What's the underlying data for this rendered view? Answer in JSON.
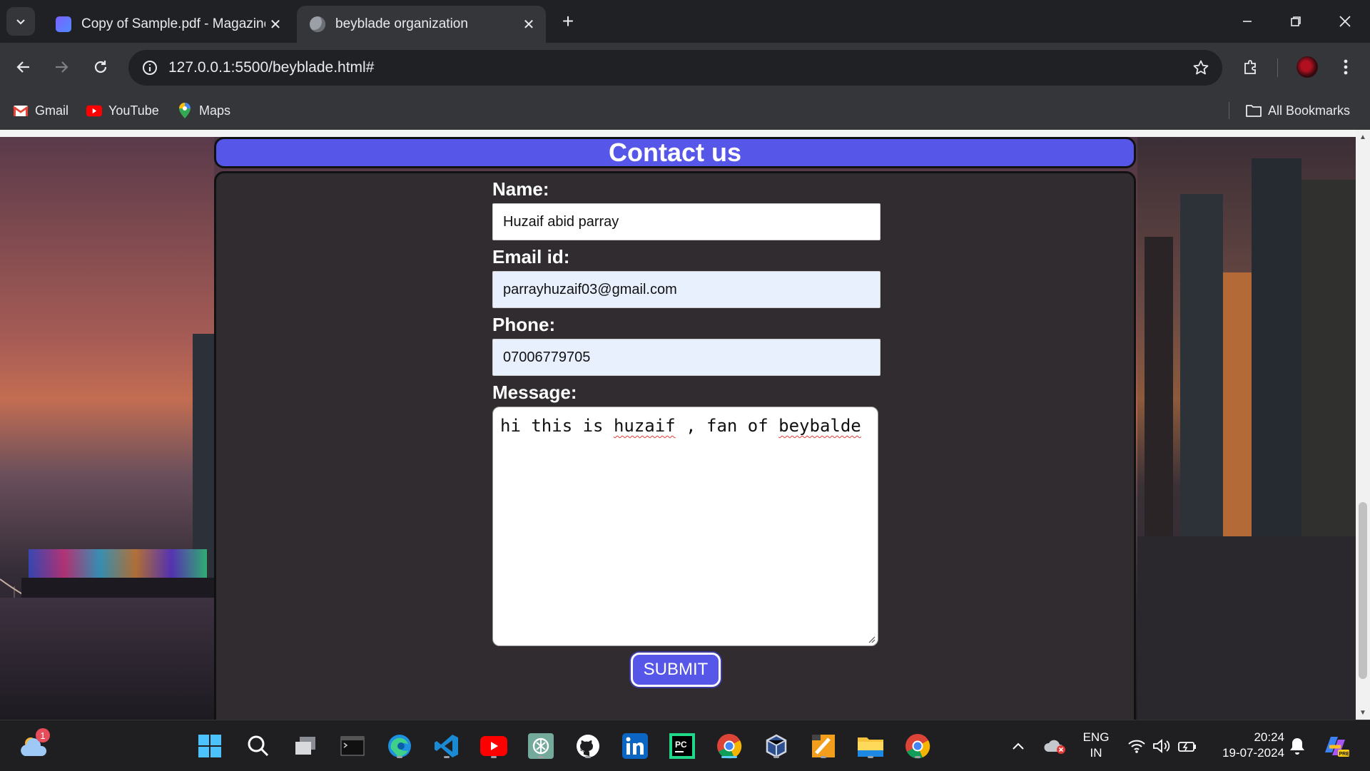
{
  "browser": {
    "tabs": [
      {
        "title": "Copy of Sample.pdf - Magazine",
        "icon": "pdf-doc-icon",
        "active": false
      },
      {
        "title": "beyblade organization",
        "icon": "globe-icon",
        "active": true
      }
    ],
    "url": "127.0.0.1:5500/beyblade.html#",
    "bookmarks": [
      {
        "label": "Gmail",
        "icon": "gmail-icon"
      },
      {
        "label": "YouTube",
        "icon": "youtube-icon"
      },
      {
        "label": "Maps",
        "icon": "maps-icon"
      }
    ],
    "all_bookmarks_label": "All Bookmarks"
  },
  "page": {
    "heading": "Contact us",
    "form": {
      "name_label": "Name:",
      "name_value": "Huzaif abid parray",
      "email_label": "Email id:",
      "email_value": "parrayhuzaif03@gmail.com",
      "phone_label": "Phone:",
      "phone_value": "07006779705",
      "message_label": "Message:",
      "message_words": [
        "hi this is ",
        "huzaif",
        " , fan of ",
        "beybalde"
      ],
      "submit_label": "SUBMIT"
    },
    "accent_color": "#5656e8"
  },
  "taskbar": {
    "weather_badge": "1",
    "apps": [
      "start-icon",
      "search-icon",
      "task-view-icon",
      "terminal-icon",
      "edge-icon",
      "vscode-icon",
      "youtube-icon",
      "chatgpt-icon",
      "github-icon",
      "linkedin-icon",
      "pycharm-icon",
      "chrome-icon",
      "virtualbox-icon",
      "app-icon",
      "file-explorer-icon",
      "chrome-icon"
    ],
    "language_line1": "ENG",
    "language_line2": "IN",
    "time": "20:24",
    "date": "19-07-2024"
  }
}
